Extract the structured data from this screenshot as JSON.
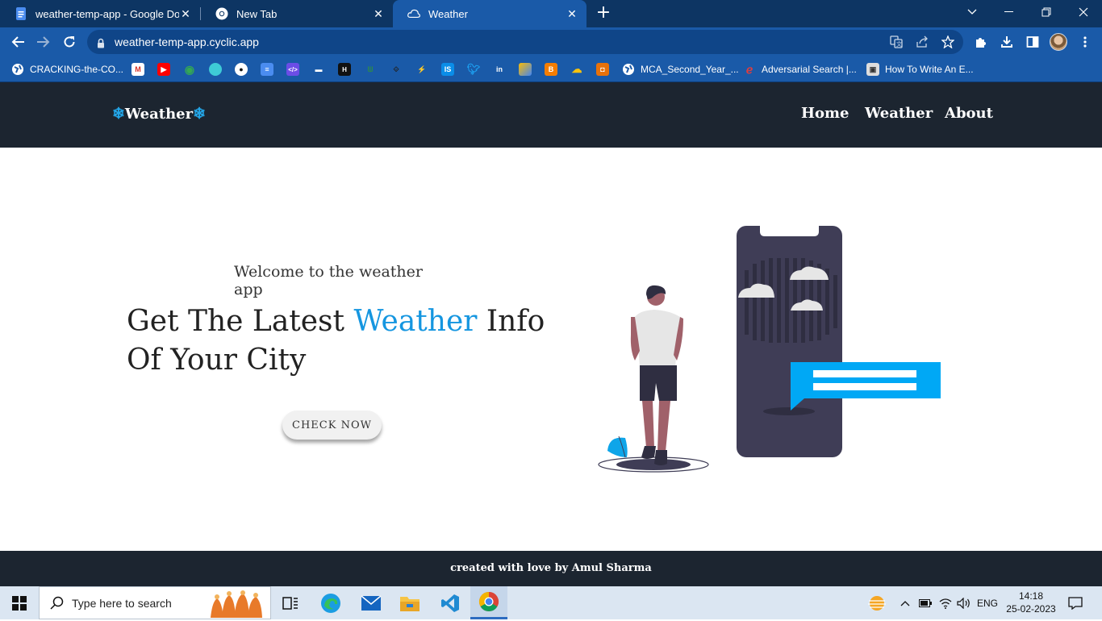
{
  "browser": {
    "tabs": [
      {
        "title": "weather-temp-app - Google Doc",
        "icon": "google-docs-icon",
        "active": false
      },
      {
        "title": "New Tab",
        "icon": "chrome-icon",
        "active": false
      },
      {
        "title": "Weather",
        "icon": "weather-cloud-icon",
        "active": true
      }
    ],
    "url": "weather-temp-app.cyclic.app",
    "bookmarks": [
      {
        "label": "CRACKING-the-CO...",
        "icon": "globe-icon"
      },
      {
        "label": "",
        "icon": "gmail-icon"
      },
      {
        "label": "",
        "icon": "youtube-icon"
      },
      {
        "label": "",
        "icon": "maps-icon"
      },
      {
        "label": "",
        "icon": "edge-ext-icon"
      },
      {
        "label": "",
        "icon": "github-icon"
      },
      {
        "label": "",
        "icon": "docs-icon"
      },
      {
        "label": "",
        "icon": "code-icon"
      },
      {
        "label": "",
        "icon": "stack-icon"
      },
      {
        "label": "",
        "icon": "hackerrank-icon"
      },
      {
        "label": "",
        "icon": "geeksforgeeks-icon"
      },
      {
        "label": "",
        "icon": "codechef-icon"
      },
      {
        "label": "",
        "icon": "codeforces-icon"
      },
      {
        "label": "",
        "icon": "interviewbit-icon"
      },
      {
        "label": "",
        "icon": "twitter-icon"
      },
      {
        "label": "",
        "icon": "linkedin-icon"
      },
      {
        "label": "",
        "icon": "ads-icon"
      },
      {
        "label": "",
        "icon": "blogger-icon"
      },
      {
        "label": "",
        "icon": "cloud-icon"
      },
      {
        "label": "",
        "icon": "app-icon"
      },
      {
        "label": "MCA_Second_Year_...",
        "icon": "globe-icon"
      },
      {
        "label": "Adversarial Search |...",
        "icon": "site-icon"
      },
      {
        "label": "How To Write An E...",
        "icon": "doc-icon"
      }
    ]
  },
  "site": {
    "brand": "Weather",
    "nav": {
      "home": "Home",
      "weather": "Weather",
      "about": "About"
    },
    "hero": {
      "subtitle": "Welcome to the weather app",
      "title_part1": "Get The Latest ",
      "title_accent": "Weather",
      "title_part2": " Info Of Your City",
      "cta": "CHECK NOW"
    },
    "footer": "created with love by Amul Sharma",
    "accent_color": "#1596e0"
  },
  "taskbar": {
    "search_placeholder": "Type here to search",
    "language": "ENG",
    "time": "14:18",
    "date": "25-02-2023"
  }
}
